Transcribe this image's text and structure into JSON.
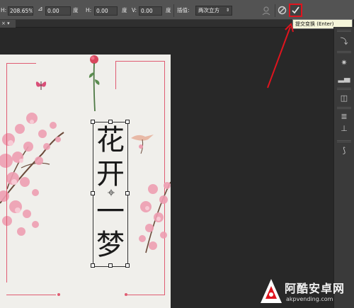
{
  "options_bar": {
    "width_label": "H:",
    "width_value": "208.65%",
    "angle_icon": "angle-icon",
    "angle_value": "0.00",
    "h_skew_label": "H:",
    "h_skew_value": "0.00",
    "h_skew_unit": "度",
    "v_skew_label": "V:",
    "v_skew_value": "0.00",
    "v_skew_unit": "度",
    "angle_unit": "度",
    "interp_label": "插值:",
    "interp_value": "两次立方",
    "warp_icon": "warp-mode-icon",
    "cancel_icon": "cancel-transform-icon",
    "commit_icon": "commit-transform-icon"
  },
  "tooltip": {
    "text": "提交变换 (Enter)"
  },
  "tab": {
    "label": "× ▾"
  },
  "document": {
    "vertical_text": [
      "花",
      "开",
      "一",
      "梦"
    ]
  },
  "watermark": {
    "title": "阿酷安卓网",
    "url": "akpvending.com"
  },
  "colors": {
    "annotation_red": "#e0141e",
    "frame_pink": "#e05c72",
    "blossom_pink": "#ee9fb2"
  }
}
